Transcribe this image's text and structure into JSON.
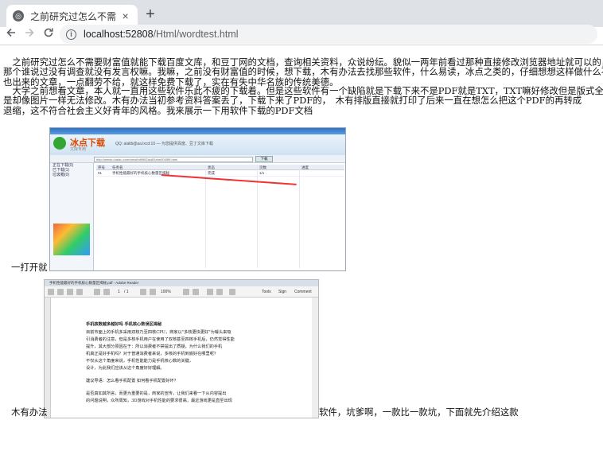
{
  "browser": {
    "tab_title": "之前研究过怎么不需要财富值就",
    "new_tab_symbol": "+",
    "tab_close_symbol": "×",
    "url_host": "localhost:52808",
    "url_path": "/Html/wordtest.html",
    "icons": {
      "back": "arrow-left-icon",
      "forward": "arrow-right-icon",
      "reload": "reload-icon",
      "site_info": "info-icon",
      "favicon": "globe-icon"
    }
  },
  "article": {
    "paragraph1": [
      "　之前研究过怎么不需要财富值就能下载百度文库，和豆丁网的文档，查询相关资料，众说纷纭。貌似一两年前看过那种直接修改浏览器地址就可以的，",
      "那个谁说过没有调查就没有发言权嘛。我嘛，之前没有财富值的时候，想下载，木有办法去找那些软件，什么易读，冰点之类的，仔细想想这样做什么不",
      "也出来的文章，一点翻劳不给，就这样免费下载了，实在有失中华名族的传统美德。"
    ],
    "paragraph2": [
      "　大学之前想看文章，本人就一直用这些软件乐此不疲的下载着。但是这些软件有一个缺陷就是下载下来不是PDF就是TXT，TXT嘛好修改但是版式全无",
      "是却像图片一样无法修改。木有办法当初参考资料答案丢了，下载下来了PDF的，　木有排版直接就打印了后来一直在想怎么把这个PDF的再转成　　　v",
      "退缩，这不符合社会主义好青年的风格。我来展示一下用软件下载的PDF文档"
    ],
    "caption1": "一打开就",
    "caption2_left": "木有办法",
    "caption2_right": "软件，坑爹啊，一款比一款坑，下面就先介绍这款"
  },
  "screenshot1": {
    "logo": "冰点下载",
    "logo_sub": "文库专用",
    "banner_note": "QQ: alalib@aa.lxcd:10 — 为您提供百度、豆丁文库下载",
    "address_text": "http://wenku.baidu.com/view/bd9982dc6f1ebe0045f9.html",
    "go_label": "下载",
    "sidebar_items": [
      "正在下载(0)",
      "已下载(1)",
      "垃圾箱(0)"
    ],
    "table_headers": [
      "序号",
      "任务名",
      "状态",
      "页数",
      "进度"
    ],
    "table_row": [
      "01",
      "手机性能最好的手机核心数量区揭秘",
      "完成",
      "1/1",
      ""
    ]
  },
  "screenshot2": {
    "title": "手机性能最好的手机核心数量区揭秘.pdf - Adobe Reader",
    "page_input": "1",
    "page_total": "/ 1",
    "zoom": "100%",
    "tool_labels": [
      "Tools",
      "Sign",
      "Comment"
    ],
    "doc_lines": [
      "手机核数越多越好吗 手机核心数误区揭秘",
      "目前市面上的手机多采用双核乃至四核CPU，商家以\"多核更快更好\"为噱头来吸",
      "引消费者的注意，但是多核手机用户在使用了双核甚至四核手机后，仍然觉得性能",
      "提升，其大部分原因在于：所以消费者不禁提出了质疑，为什么我们的手机",
      "机真正是好手机吗？对于普通消费者来说，多核的手机到底好在哪里呢？",
      "不仅从这个角度来说，手机性能能力是手机核心数的关键，",
      "设计，为此我们应该从这个角度好好理解。",
      "建议导语：怎么看手机配置 如何看手机配置好坏？",
      "是否真如其所言，而更为重要的是，商家的宣传，让我们来看一下从内容提出",
      "的问题说明，众所周知，3D游戏对手机性能的要求很高，最近游戏更是直至出现"
    ]
  }
}
